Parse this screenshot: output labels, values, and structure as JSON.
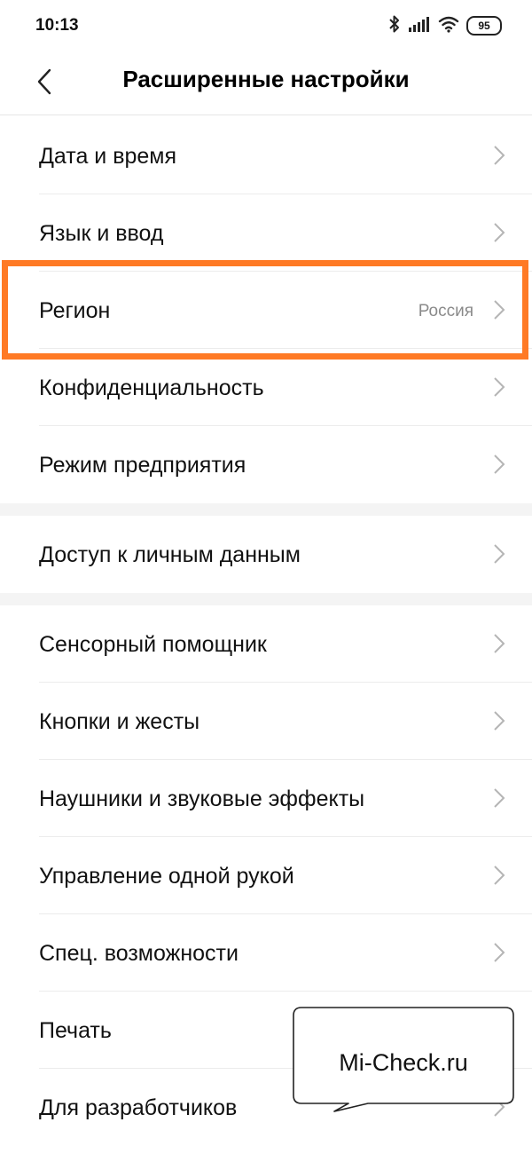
{
  "status_bar": {
    "time": "10:13",
    "battery_level": "95",
    "icons": [
      "bluetooth-icon",
      "signal-icon",
      "wifi-icon",
      "battery-icon"
    ]
  },
  "header": {
    "title": "Расширенные настройки",
    "back_icon": "chevron-left-icon"
  },
  "sections": [
    {
      "items": [
        {
          "label": "Дата и время"
        },
        {
          "label": "Язык и ввод"
        },
        {
          "label": "Регион",
          "value": "Россия",
          "highlighted": true
        },
        {
          "label": "Конфиденциальность"
        },
        {
          "label": "Режим предприятия"
        }
      ]
    },
    {
      "items": [
        {
          "label": "Доступ к личным данным"
        }
      ]
    },
    {
      "items": [
        {
          "label": "Сенсорный помощник"
        },
        {
          "label": "Кнопки и жесты"
        },
        {
          "label": "Наушники и звуковые эффекты"
        },
        {
          "label": "Управление одной рукой"
        },
        {
          "label": "Спец. возможности"
        },
        {
          "label": "Печать"
        },
        {
          "label": "Для разработчиков"
        }
      ]
    }
  ],
  "watermark": {
    "text": "Mi-Check.ru"
  },
  "colors": {
    "highlight": "#ff7a25",
    "secondary_text": "#8a8a8a",
    "chevron": "#b5b5b5",
    "divider": "#ececec"
  }
}
